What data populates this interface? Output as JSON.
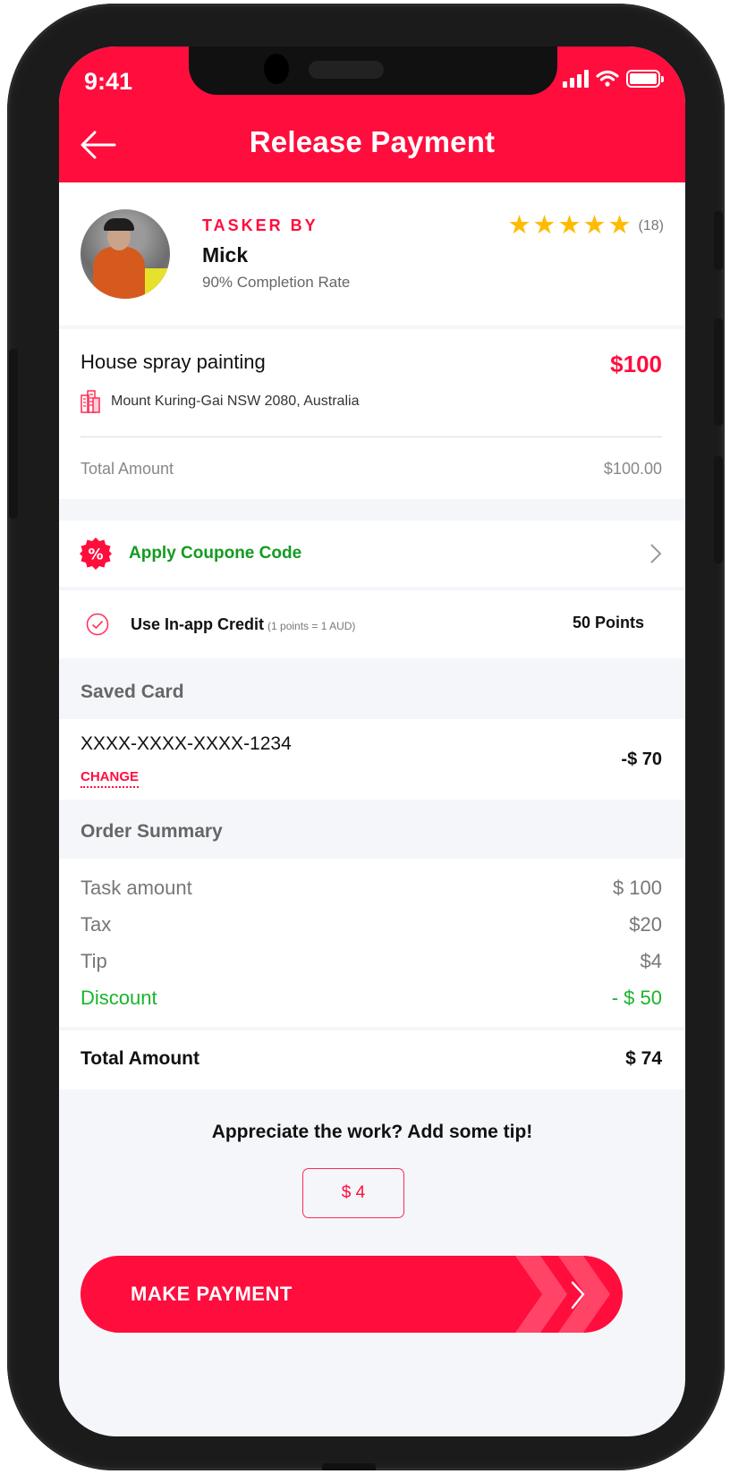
{
  "status_bar": {
    "time": "9:41"
  },
  "header": {
    "title": "Release Payment"
  },
  "tasker": {
    "label": "TASKER BY",
    "name": "Mick",
    "completion_rate": "90% Completion  Rate",
    "rating_stars": 5,
    "rating_max": 5,
    "review_count": "(18)"
  },
  "task": {
    "name": "House spray painting",
    "price": "$100",
    "location": "Mount Kuring-Gai NSW 2080, Australia",
    "total_label": "Total Amount",
    "total_value": "$100.00"
  },
  "coupon": {
    "label": "Apply Coupone Code"
  },
  "credit": {
    "label": "Use In-app Credit",
    "sub": "(1 points = 1 AUD)",
    "points": "50 Points"
  },
  "saved_card": {
    "heading": "Saved Card",
    "number": "XXXX-XXXX-XXXX-1234",
    "change_label": "CHANGE",
    "amount": "-$ 70"
  },
  "order_summary": {
    "heading": "Order Summary",
    "rows": [
      {
        "label": "Task amount",
        "value": "$ 100"
      },
      {
        "label": "Tax",
        "value": "$20"
      },
      {
        "label": "Tip",
        "value": "$4"
      },
      {
        "label": "Discount",
        "value": "- $ 50"
      }
    ],
    "total_label": "Total Amount",
    "total_value": "$ 74"
  },
  "tip": {
    "prompt": "Appreciate the work? Add some tip!",
    "value": "$ 4"
  },
  "pay_button": {
    "label": "MAKE PAYMENT"
  },
  "colors": {
    "brand": "#ff0d3d",
    "discount": "#19b42c",
    "coupon_text": "#129b21",
    "star": "#ffbb00",
    "background": "#f5f6fa"
  }
}
